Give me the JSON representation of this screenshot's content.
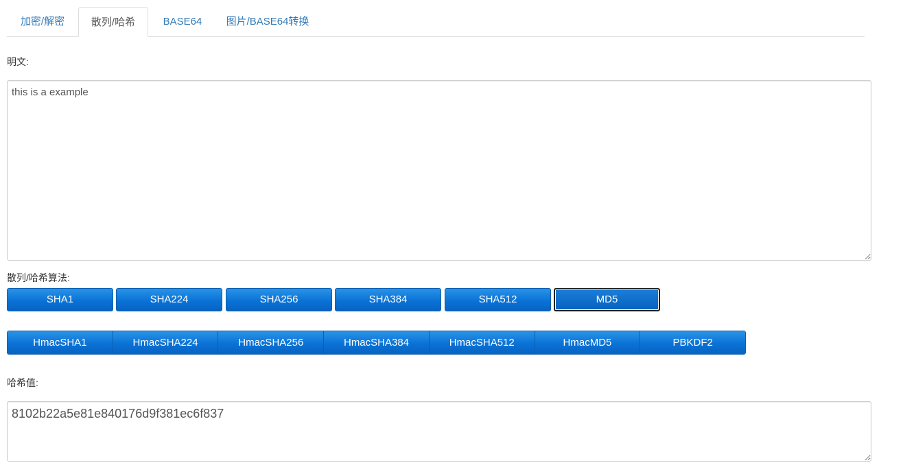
{
  "tabs": [
    {
      "label": "加密/解密",
      "active": false
    },
    {
      "label": "散列/哈希",
      "active": true
    },
    {
      "label": "BASE64",
      "active": false
    },
    {
      "label": "图片/BASE64转换",
      "active": false
    }
  ],
  "plaintext": {
    "label": "明文:",
    "value": "this is a example"
  },
  "algorithm": {
    "label": "散列/哈希算法:",
    "hash_buttons": [
      "SHA1",
      "SHA224",
      "SHA256",
      "SHA384",
      "SHA512",
      "MD5"
    ],
    "selected": "MD5",
    "hmac_buttons": [
      "HmacSHA1",
      "HmacSHA224",
      "HmacSHA256",
      "HmacSHA384",
      "HmacSHA512",
      "HmacMD5",
      "PBKDF2"
    ]
  },
  "hash_output": {
    "label": "哈希值:",
    "value": "8102b22a5e81e840176d9f381ec6f837"
  },
  "colors": {
    "tab_link": "#337ab7",
    "button_blue": "#0a72d6",
    "border": "#cccccc"
  }
}
